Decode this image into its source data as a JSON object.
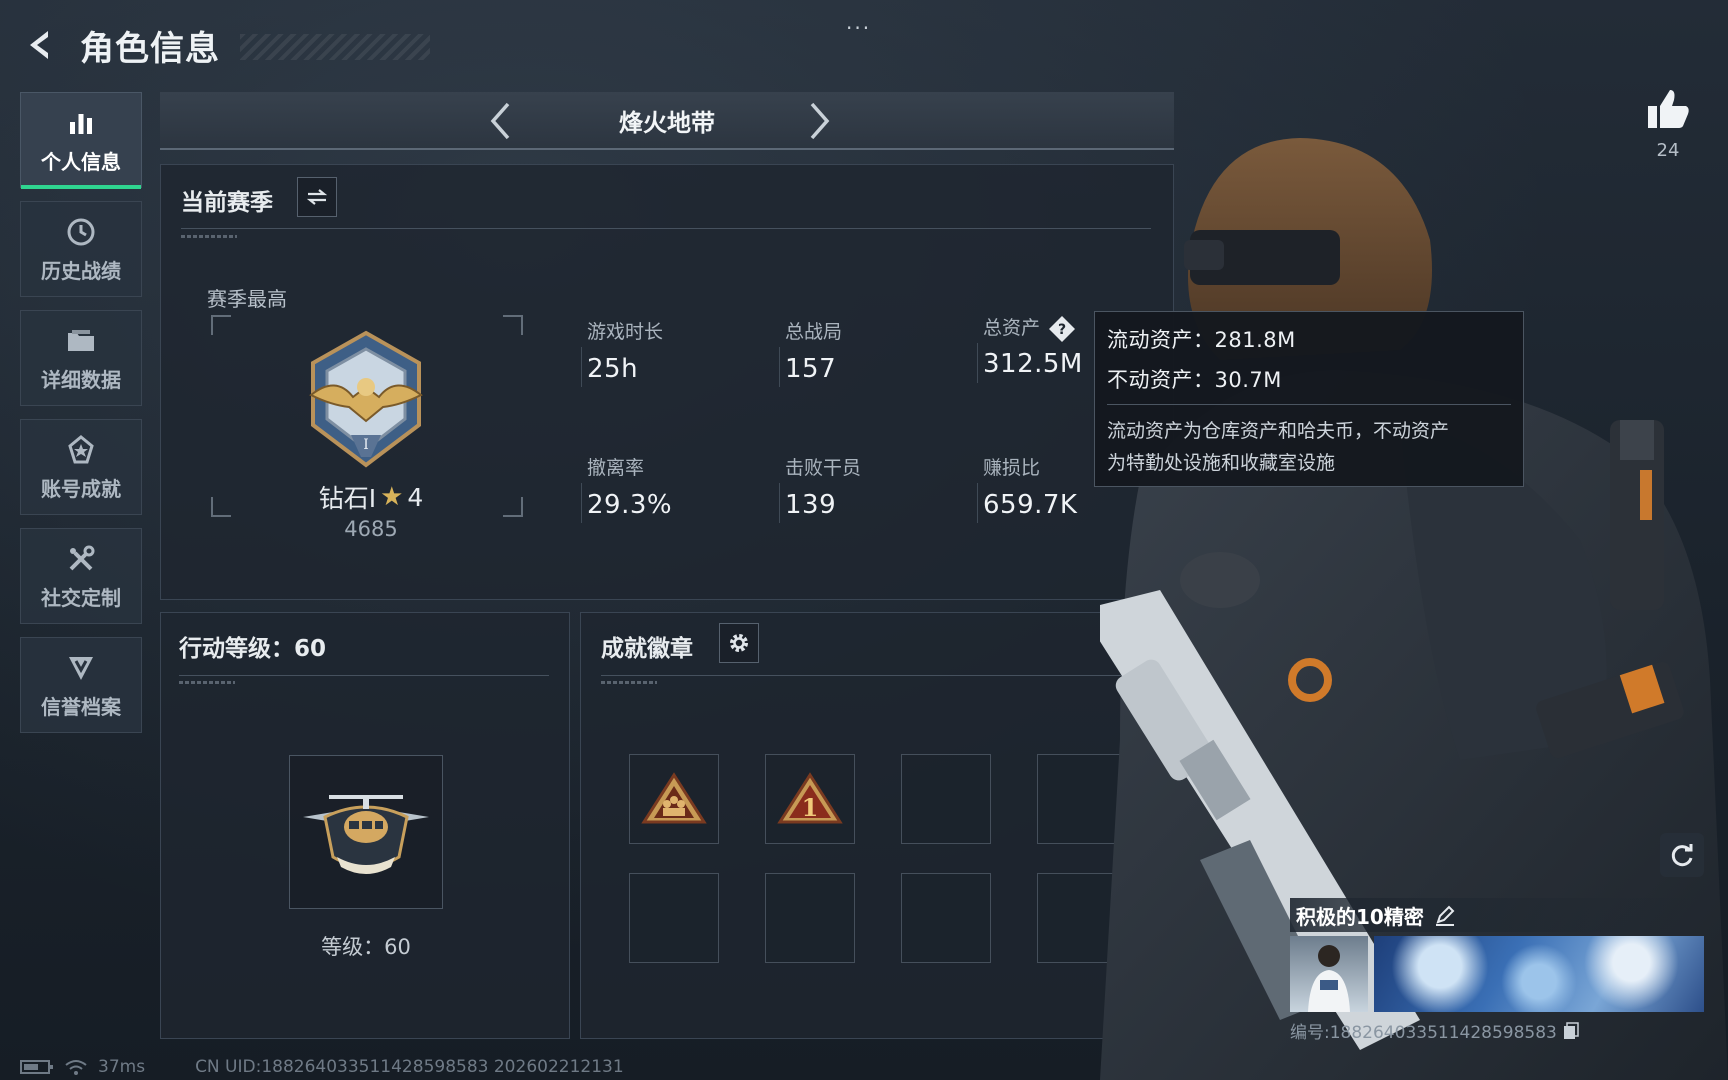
{
  "header": {
    "title": "角色信息",
    "more_menu": "..."
  },
  "nav": {
    "items": [
      {
        "label": "个人信息",
        "icon": "bar-chart-icon",
        "active": true
      },
      {
        "label": "历史战绩",
        "icon": "history-icon",
        "active": false
      },
      {
        "label": "详细数据",
        "icon": "folder-icon",
        "active": false
      },
      {
        "label": "账号成就",
        "icon": "medal-icon",
        "active": false
      },
      {
        "label": "社交定制",
        "icon": "tools-icon",
        "active": false
      },
      {
        "label": "信誉档案",
        "icon": "shield-badge-icon",
        "active": false
      }
    ]
  },
  "mode": {
    "title": "烽火地带"
  },
  "season": {
    "title": "当前赛季",
    "best_label": "赛季最高",
    "rank_name": "钻石I",
    "rank_stars": "4",
    "rank_points": "4685",
    "stats": [
      {
        "label": "游戏时长",
        "value": "25h"
      },
      {
        "label": "总战局",
        "value": "157"
      },
      {
        "label": "总资产",
        "value": "312.5M"
      },
      {
        "label": "撤离率",
        "value": "29.3%"
      },
      {
        "label": "击败干员",
        "value": "139"
      },
      {
        "label": "赚损比",
        "value": "659.7K"
      }
    ]
  },
  "tooltip": {
    "liquid": "流动资产：281.8M",
    "fixed": "不动资产：30.7M",
    "desc_line1": "流动资产为仓库资产和哈夫币，不动资产",
    "desc_line2": "为特勤处设施和收藏室设施"
  },
  "level": {
    "title": "行动等级：60",
    "level_text": "等级：60"
  },
  "badges": {
    "title": "成就徽章",
    "slots": 8,
    "filled": 2
  },
  "profile": {
    "likes": "24",
    "name": "积极的10精密",
    "id_text": "编号:18826403351142859858​3"
  },
  "footer": {
    "ping": "37ms",
    "uid": "CN UID:18826403351142859858​3 202602212131"
  },
  "colors": {
    "accent": "#2fd590",
    "gold": "#d8b35a",
    "panel": "#1e2630"
  }
}
